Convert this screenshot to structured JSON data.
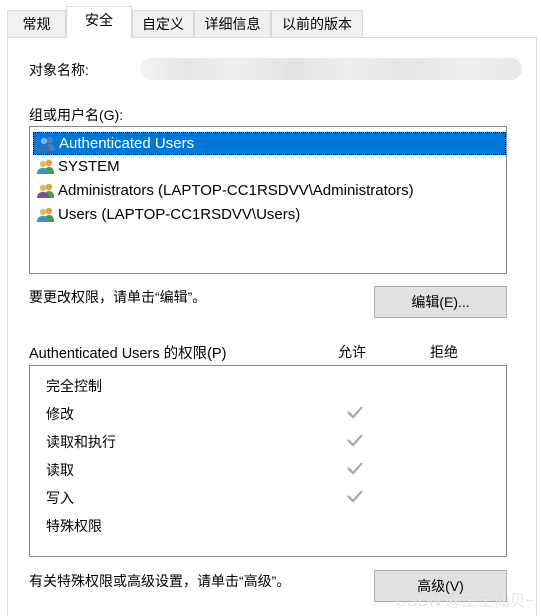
{
  "tabs": [
    {
      "label": "常规",
      "active": false
    },
    {
      "label": "安全",
      "active": true
    },
    {
      "label": "自定义",
      "active": false
    },
    {
      "label": "详细信息",
      "active": false
    },
    {
      "label": "以前的版本",
      "active": false
    }
  ],
  "object_name_label": "对象名称:",
  "groups_label": "组或用户名(G):",
  "groups": [
    {
      "name": "Authenticated Users",
      "selected": true,
      "icon": "users-icon"
    },
    {
      "name": "SYSTEM",
      "selected": false,
      "icon": "users-icon"
    },
    {
      "name": "Administrators (LAPTOP-CC1RSDVV\\Administrators)",
      "selected": false,
      "icon": "users-icon"
    },
    {
      "name": "Users (LAPTOP-CC1RSDVV\\Users)",
      "selected": false,
      "icon": "users-icon"
    }
  ],
  "edit_hint": "要更改权限，请单击“编辑”。",
  "edit_button": "编辑(E)...",
  "permissions_title": "Authenticated Users 的权限(P)",
  "allow_header": "允许",
  "deny_header": "拒绝",
  "permissions": [
    {
      "name": "完全控制",
      "allow": false,
      "deny": false
    },
    {
      "name": "修改",
      "allow": true,
      "deny": false
    },
    {
      "name": "读取和执行",
      "allow": true,
      "deny": false
    },
    {
      "name": "读取",
      "allow": true,
      "deny": false
    },
    {
      "name": "写入",
      "allow": true,
      "deny": false
    },
    {
      "name": "特殊权限",
      "allow": false,
      "deny": false
    }
  ],
  "advanced_hint": "有关特殊权限或高级设置，请单击“高级”。",
  "advanced_button": "高级(V)",
  "watermark": "CSDN @王王仙贝~",
  "colors": {
    "selection": "#0078d7",
    "check": "#a0a0a0",
    "border": "#828790"
  }
}
